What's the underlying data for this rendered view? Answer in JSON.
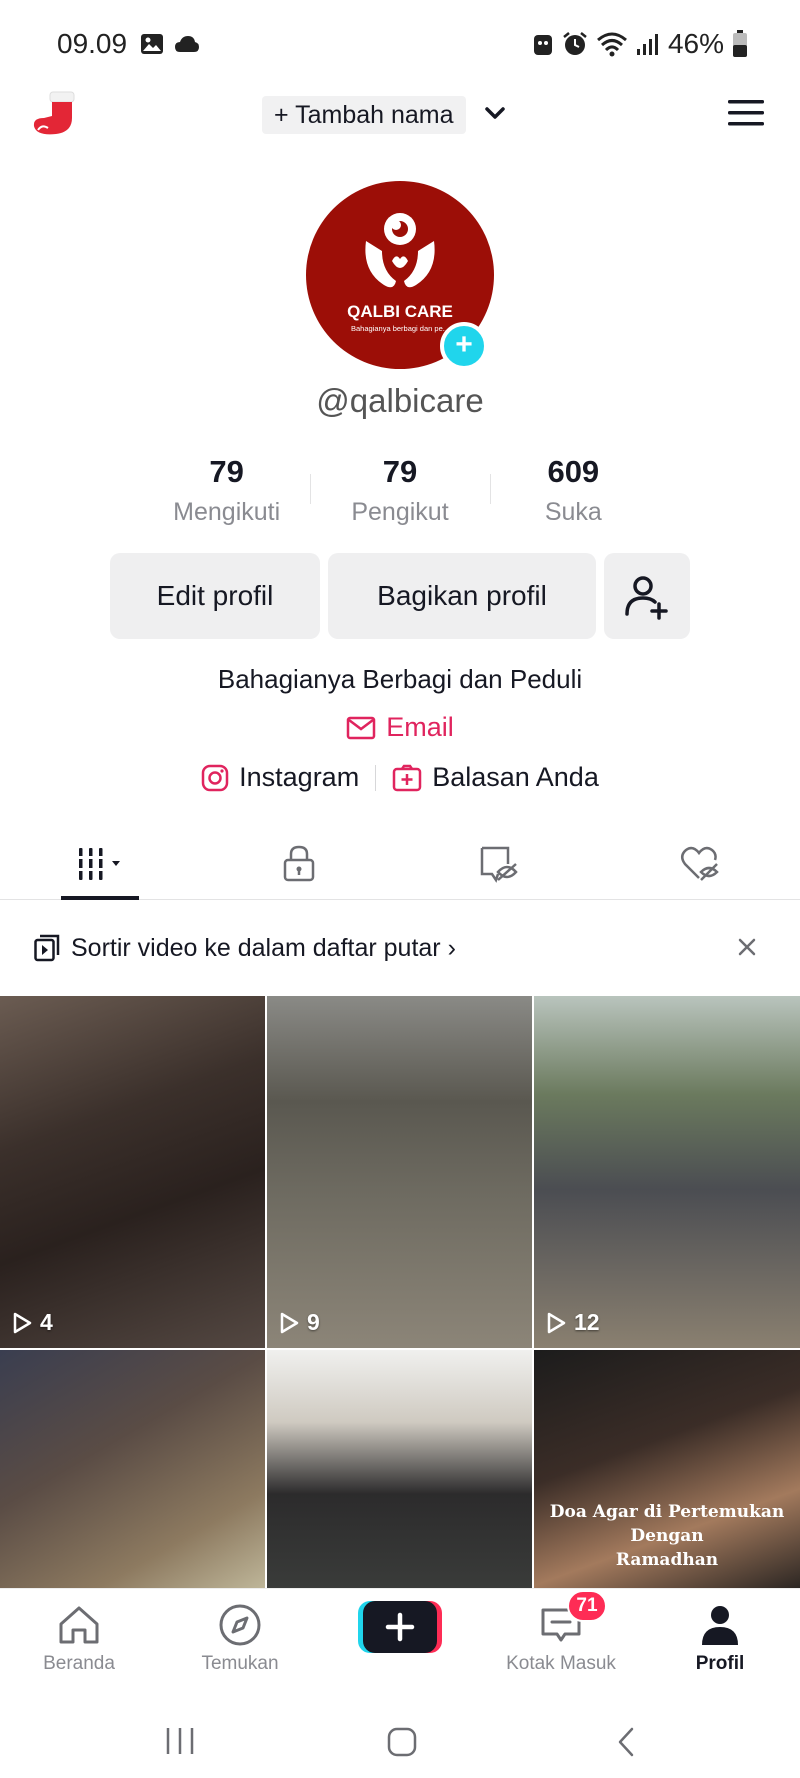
{
  "status_bar": {
    "time": "09.09",
    "battery": "46%"
  },
  "header": {
    "add_name": "+ Tambah nama"
  },
  "profile": {
    "avatar_brand": "QALBI CARE",
    "avatar_tagline": "Bahagianya berbagi dan pe...",
    "username": "@qalbicare"
  },
  "stats": [
    {
      "value": "79",
      "label": "Mengikuti"
    },
    {
      "value": "79",
      "label": "Pengikut"
    },
    {
      "value": "609",
      "label": "Suka"
    }
  ],
  "actions": {
    "edit": "Edit profil",
    "share": "Bagikan profil"
  },
  "bio": {
    "text": "Bahagianya Berbagi dan Peduli",
    "email": "Email",
    "instagram": "Instagram",
    "replies": "Balasan Anda"
  },
  "playlist_prompt": "Sortir video ke dalam daftar putar",
  "videos": [
    {
      "views": "4"
    },
    {
      "views": "9"
    },
    {
      "views": "12"
    },
    {
      "views": ""
    },
    {
      "views": ""
    },
    {
      "views": "",
      "overlay_line1": "Doa Agar di Pertemukan Dengan",
      "overlay_line2": "Ramadhan"
    }
  ],
  "bottom_nav": {
    "home": "Beranda",
    "discover": "Temukan",
    "inbox": "Kotak Masuk",
    "inbox_badge": "71",
    "profile": "Profil"
  },
  "colors": {
    "accent_pink": "#e0245e",
    "badge_red": "#fe2c55",
    "avatar_red": "#9c0e07",
    "cyan": "#20d5ec"
  }
}
